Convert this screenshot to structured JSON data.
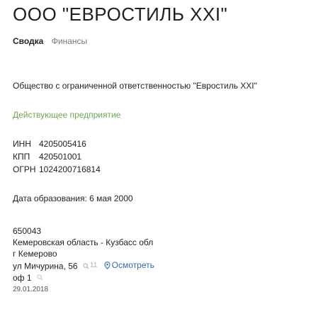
{
  "company": {
    "short_name": "ООО \"ЕВРОСТИЛЬ XXI\"",
    "full_name": "Общество с ограниченной ответственностью \"Евростиль XXI\"",
    "status": "Действующее предприятие",
    "status_color": "#6aa84f"
  },
  "tabs": {
    "summary": "Сводка",
    "finance": "Финансы"
  },
  "codes": {
    "inn_label": "ИНН",
    "inn_value": "4205005416",
    "kpp_label": "КПП",
    "kpp_value": "420501001",
    "ogrn_label": "ОГРН",
    "ogrn_value": "1024200716814"
  },
  "registration": {
    "text": "Дата образования: 6 мая 2000"
  },
  "address": {
    "postal_code": "650043",
    "region": "Кемеровская область - Кузбасс обл",
    "city": "г Кемерово",
    "street": "ул Мичурина, 56",
    "street_search_count": "11",
    "map_label": "Осмотреть",
    "office": "оф 1",
    "date": "29.01.2018"
  },
  "icons": {
    "search": "search-icon",
    "map_pin": "map-pin-icon"
  }
}
